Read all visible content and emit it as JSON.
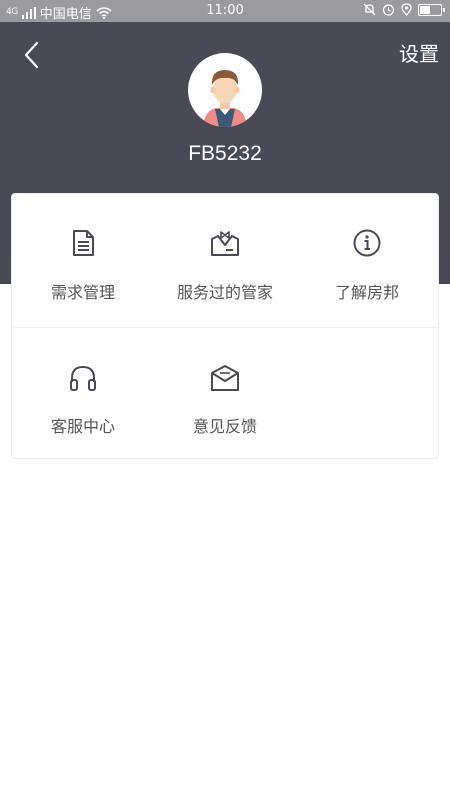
{
  "status_bar": {
    "signal_text": "4G",
    "carrier": "中国电信",
    "time": "11:00",
    "battery_level": 0.55
  },
  "header": {
    "settings_label": "设置",
    "username": "FB5232",
    "background_color": "#4a4a57"
  },
  "menu": {
    "items": [
      {
        "label": "需求管理",
        "icon": "document-icon"
      },
      {
        "label": "服务过的管家",
        "icon": "butler-icon"
      },
      {
        "label": "了解房邦",
        "icon": "info-icon"
      },
      {
        "label": "客服中心",
        "icon": "headphones-icon"
      },
      {
        "label": "意见反馈",
        "icon": "mail-icon"
      }
    ]
  }
}
